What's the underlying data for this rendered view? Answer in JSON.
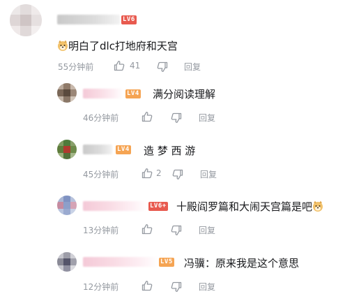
{
  "colors": {
    "meta": "#9499a0",
    "level_orange": "#f5a453",
    "level_red": "#e85a4f",
    "text": "#18191c"
  },
  "top_comment": {
    "level": "LV6",
    "text": "明白了dlc打地府和天宫",
    "emoji": "doge-icon",
    "time": "55分钟前",
    "likes": "41",
    "reply_label": "回复"
  },
  "replies": [
    {
      "level": "LV4",
      "text": "满分阅读理解",
      "time": "46分钟前",
      "likes": "",
      "reply_label": "回复"
    },
    {
      "level": "LV4",
      "text": "造 梦 西 游",
      "time": "45分钟前",
      "likes": "2",
      "reply_label": "回复"
    },
    {
      "level": "LV6+",
      "text": "十殿阎罗篇和大闹天宫篇是吧",
      "emoji": "doge-icon",
      "time": "13分钟前",
      "likes": "",
      "reply_label": "回复"
    },
    {
      "level": "LV5",
      "text": "冯骥：原来我是这个意思",
      "time": "12分钟前",
      "likes": "",
      "reply_label": "回复"
    }
  ]
}
